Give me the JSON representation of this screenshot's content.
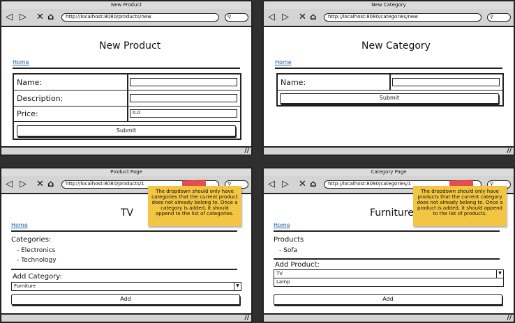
{
  "colors": {
    "note": "#f2c542",
    "tape": "#e33a3a",
    "link": "#1f5fa8",
    "chrome": "#d4d4d4"
  },
  "icons": {
    "back": "◁",
    "forward": "▷",
    "stop": "✕",
    "home": "⌂",
    "search": "⚲",
    "grip": "//"
  },
  "windows": [
    {
      "title": "New Product",
      "url": "http://localhost:8080/products/new",
      "heading": "New Product",
      "home": "Home",
      "fields": [
        {
          "label": "Name:",
          "value": ""
        },
        {
          "label": "Description:",
          "value": ""
        },
        {
          "label": "Price:",
          "value": "0.0"
        }
      ],
      "submit": "Submit"
    },
    {
      "title": "New Category",
      "url": "http://localhost:8080/categories/new",
      "heading": "New Category",
      "home": "Home",
      "fields": [
        {
          "label": "Name:",
          "value": ""
        }
      ],
      "submit": "Submit"
    },
    {
      "title": "Product Page",
      "url": "http://localhost:8080/products/1",
      "heading": "TV",
      "home": "Home",
      "list_label": "Categories:",
      "items": [
        "- Electronics",
        "- Technology"
      ],
      "add_label": "Add Category:",
      "select_value": "Furniture",
      "add_button": "Add",
      "note": "The dropdown should only have categories that the current product does not already belong to. Once a category is added, it should append to the list of categories."
    },
    {
      "title": "Category Page",
      "url": "http://localhost:8080/categories/1",
      "heading": "Furniture",
      "home": "Home",
      "list_label": "Products",
      "items": [
        "- Sofa"
      ],
      "add_label": "Add Product:",
      "select_value": "TV",
      "select_option": "Lamp",
      "add_button": "Add",
      "note": "The dropdown should only have products that the current category does not already belong to. Once a product is added, it should append to the list of products."
    }
  ]
}
